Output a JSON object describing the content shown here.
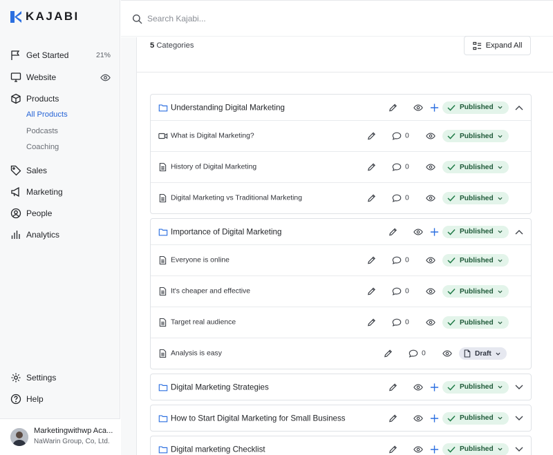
{
  "app": {
    "logo_text": "KAJABI"
  },
  "search": {
    "placeholder": "Search Kajabi..."
  },
  "sidebar": {
    "get_started": {
      "label": "Get Started",
      "progress": "21%"
    },
    "website": {
      "label": "Website"
    },
    "products": {
      "label": "Products",
      "sub": [
        "All Products",
        "Podcasts",
        "Coaching"
      ]
    },
    "sales": {
      "label": "Sales"
    },
    "marketing": {
      "label": "Marketing"
    },
    "people": {
      "label": "People"
    },
    "analytics": {
      "label": "Analytics"
    },
    "settings": {
      "label": "Settings"
    },
    "help": {
      "label": "Help"
    }
  },
  "user": {
    "name": "Marketingwithwp Aca...",
    "org": "NaWarin Group, Co, Ltd."
  },
  "main": {
    "category_count": "5",
    "category_word": "Categories",
    "expand_all": "Expand All",
    "categories": [
      {
        "title": "Understanding Digital Marketing",
        "status": "Published",
        "expanded": true,
        "lessons": [
          {
            "title": "What is Digital Marketing?",
            "type": "video",
            "comments": "0",
            "status": "Published"
          },
          {
            "title": "History of Digital Marketing",
            "type": "text",
            "comments": "0",
            "status": "Published"
          },
          {
            "title": "Digital Marketing vs Traditional Marketing",
            "type": "text",
            "comments": "0",
            "status": "Published"
          }
        ]
      },
      {
        "title": "Importance of Digital Marketing",
        "status": "Published",
        "expanded": true,
        "lessons": [
          {
            "title": "Everyone is online",
            "type": "text",
            "comments": "0",
            "status": "Published"
          },
          {
            "title": "It's cheaper and effective",
            "type": "text",
            "comments": "0",
            "status": "Published"
          },
          {
            "title": "Target real audience",
            "type": "text",
            "comments": "0",
            "status": "Published"
          },
          {
            "title": "Analysis is easy",
            "type": "text",
            "comments": "0",
            "status": "Draft"
          }
        ]
      },
      {
        "title": "Digital Marketing Strategies",
        "status": "Published",
        "expanded": false,
        "lessons": []
      },
      {
        "title": "How to Start Digital Marketing for Small Business",
        "status": "Published",
        "expanded": false,
        "lessons": []
      },
      {
        "title": "Digital marketing Checklist",
        "status": "Published",
        "expanded": false,
        "lessons": []
      }
    ]
  },
  "colors": {
    "accent": "#2563d6",
    "published_bg": "#e3f4ea",
    "draft_bg": "#e6e8f0",
    "logo_blue": "#2b6fe0"
  }
}
